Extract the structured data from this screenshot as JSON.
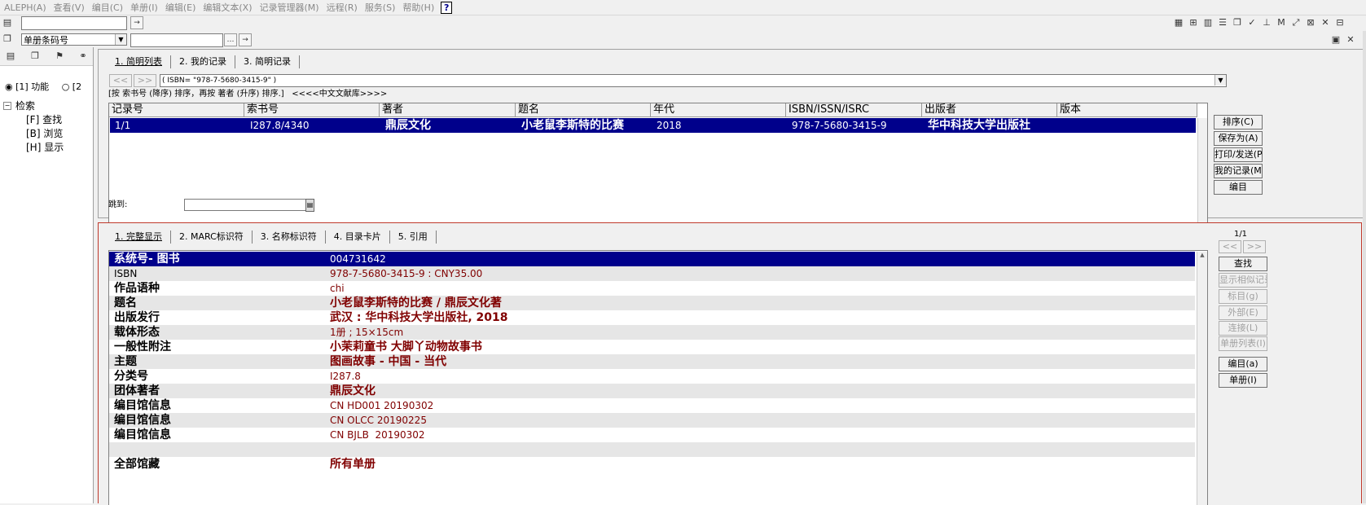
{
  "menu": [
    "ALEPH(A)",
    "查看(V)",
    "编目(C)",
    "单册(I)",
    "编辑(E)",
    "编辑文本(X)",
    "记录管理器(M)",
    "远程(R)",
    "服务(S)",
    "帮助(H)"
  ],
  "help_glyph": "?",
  "toolbar2": {
    "search_type": "单册条码号",
    "lookup_glyph": "…"
  },
  "left_tabs": {
    "radio1": "[1] 功能",
    "radio2": "[2"
  },
  "tree": {
    "root": "检索",
    "items": [
      "[F] 查找",
      "[B] 浏览",
      "[H] 显示"
    ]
  },
  "top_pane": {
    "tabs": [
      "1. 简明列表",
      "2. 我的记录",
      "3. 简明记录"
    ],
    "prev": "<<",
    "next": ">>",
    "query": "( ISBN= \"978-7-5680-3415-9\" )",
    "sort_note": "[按 索书号 (降序) 排序，再按 著者 (升序) 排序.]   <<<<中文文献库>>>>",
    "columns": [
      "记录号",
      "索书号",
      "著者",
      "题名",
      "年代",
      "ISBN/ISSN/ISRC",
      "出版者",
      "版本"
    ],
    "rows": [
      {
        "no": "1/1",
        "callno": "I287.8/4340",
        "author": "鼎辰文化",
        "title": "小老鼠李斯特的比赛",
        "year": "2018",
        "isbn": "978-7-5680-3415-9",
        "publisher": "华中科技大学出版社",
        "edition": ""
      }
    ],
    "jump_label": "跳到:",
    "buttons": [
      "排序(C)",
      "保存为(A)",
      "打印/发送(P)",
      "我的记录(M)",
      "编目"
    ]
  },
  "bottom_pane": {
    "tabs": [
      "1. 完整显示",
      "2. MARC标识符",
      "3. 名称标识符",
      "4. 目录卡片",
      "5. 引用"
    ],
    "counter": "1/1",
    "prev": "<<",
    "next": ">>",
    "fields": [
      {
        "label": "系统号- 图书",
        "value": "004731642",
        "big": false
      },
      {
        "label": "ISBN",
        "value": "978-7-5680-3415-9 : CNY35.00",
        "big": false
      },
      {
        "label": "作品语种",
        "value": "chi",
        "big": false
      },
      {
        "label": "题名",
        "value": "小老鼠李斯特的比赛 / 鼎辰文化著",
        "big": true
      },
      {
        "label": "出版发行",
        "value": "武汉 : 华中科技大学出版社, 2018",
        "big": true
      },
      {
        "label": "载体形态",
        "value": "1册 ; 15×15cm",
        "big": false
      },
      {
        "label": "一般性附注",
        "value": "小茉莉童书 大脚丫动物故事书",
        "big": true
      },
      {
        "label": "主题",
        "value": "图画故事 - 中国 - 当代",
        "big": true
      },
      {
        "label": "分类号",
        "value": "I287.8",
        "big": false
      },
      {
        "label": "团体著者",
        "value": "鼎辰文化",
        "big": true
      },
      {
        "label": "编目馆信息",
        "value": "CN HD001 20190302",
        "big": false
      },
      {
        "label": "编目馆信息",
        "value": "CN OLCC 20190225",
        "big": false
      },
      {
        "label": "编目馆信息",
        "value": "CN BJLB  20190302",
        "big": false
      },
      {
        "label": "",
        "value": "",
        "big": false
      },
      {
        "label": "全部馆藏",
        "value": "所有单册",
        "big": true
      }
    ],
    "buttons": [
      {
        "label": "查找",
        "enabled": true
      },
      {
        "label": "显示相似记录(",
        "enabled": false
      },
      {
        "label": "标目(g)",
        "enabled": false
      },
      {
        "label": "外部(E)",
        "enabled": false
      },
      {
        "label": "连接(L)",
        "enabled": false
      },
      {
        "label": "单册列表(I)",
        "enabled": false
      },
      {
        "label": "编目(a)",
        "enabled": true
      },
      {
        "label": "单册(I)",
        "enabled": true
      }
    ]
  },
  "colors": {
    "selection": "#00008b",
    "value_text": "#800000",
    "pane_border": "#c0392b",
    "row_alt": "#e6e6e6"
  }
}
